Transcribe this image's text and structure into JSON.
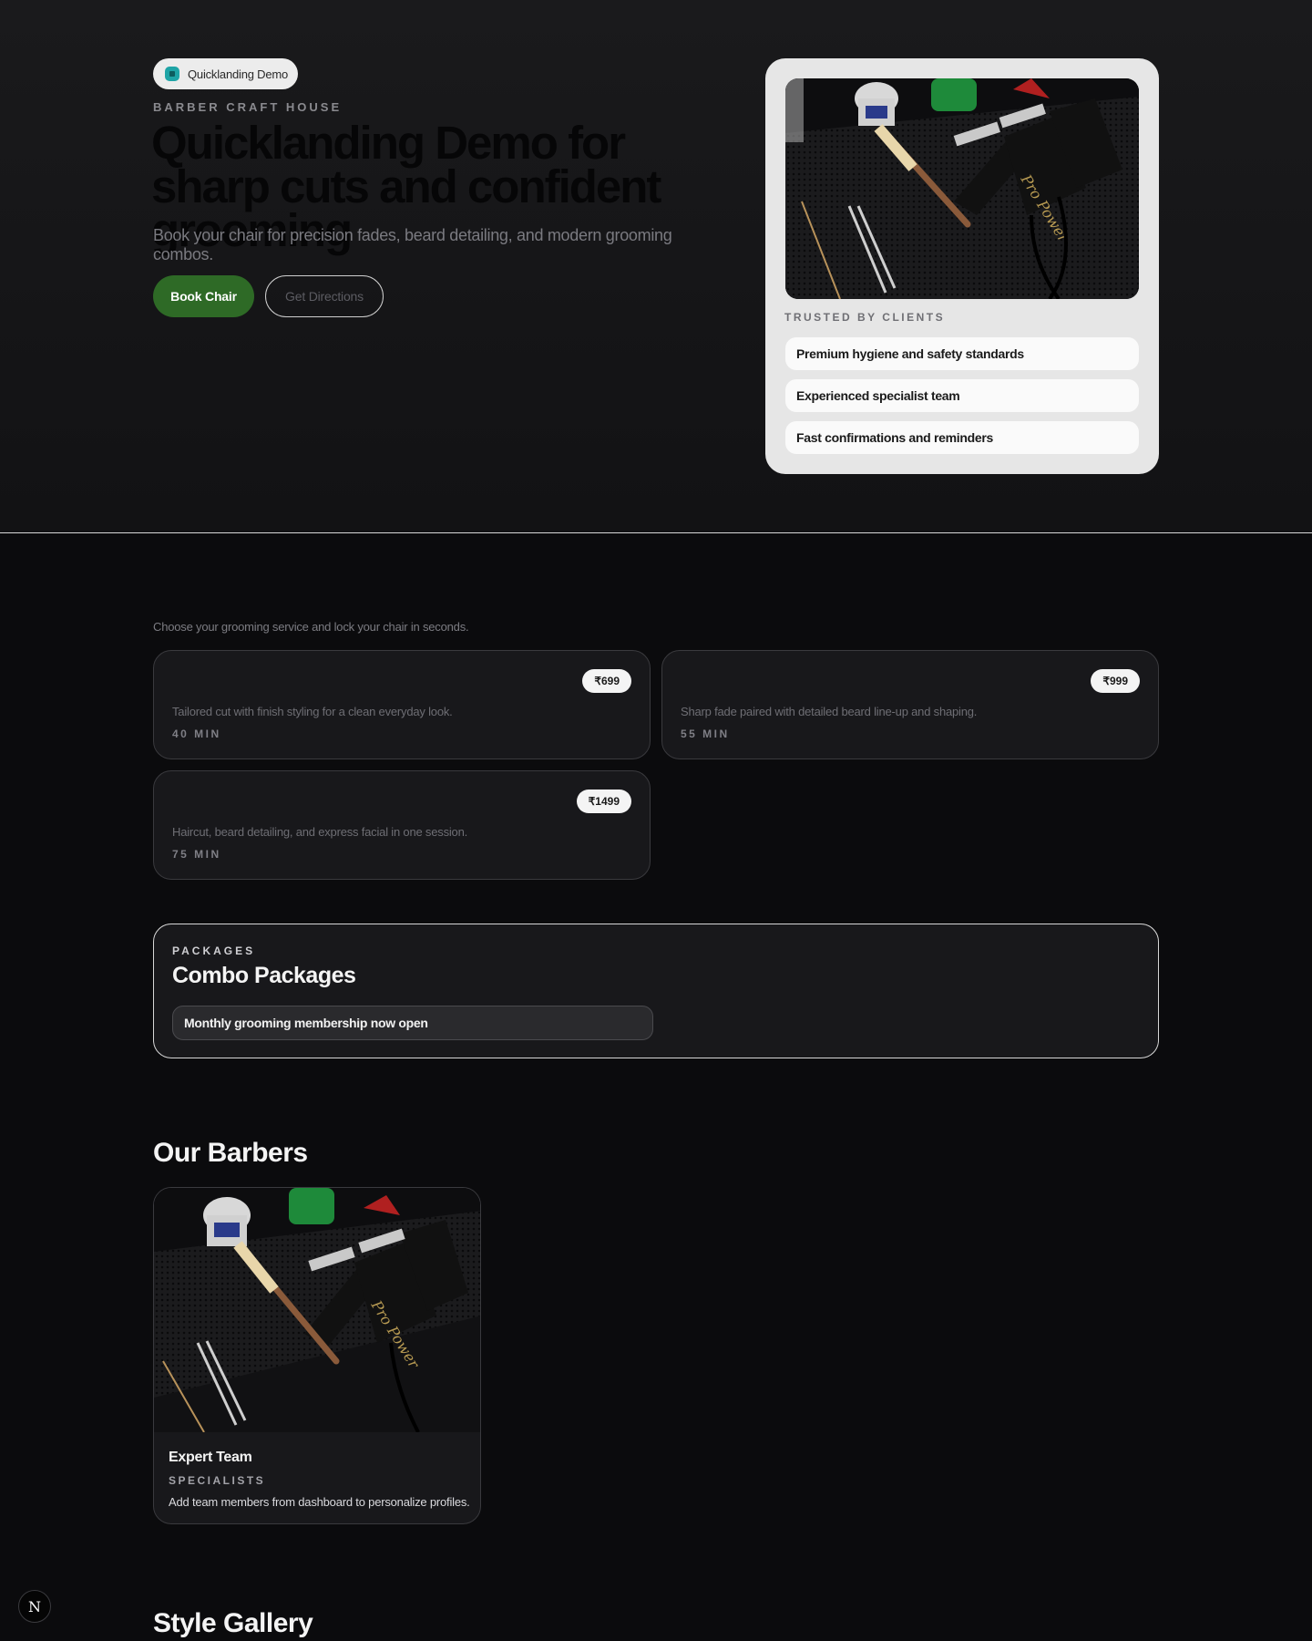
{
  "colors": {
    "background": "#0b0b0d",
    "accent_green": "#2e6a26",
    "card_light": "#e6e6e6",
    "card_dark": "#18181b",
    "badge_logo": "#1ea4a6"
  },
  "hero": {
    "badge_label": "Quicklanding Demo",
    "badge_icon": "app-logo-icon",
    "eyebrow": "BARBER CRAFT HOUSE",
    "title": "Quicklanding Demo for sharp cuts and confident grooming",
    "subtitle": "Book your chair for precision fades, beard detailing, and modern grooming combos.",
    "primary_button": "Book Chair",
    "secondary_button": "Get Directions"
  },
  "trust": {
    "label": "TRUSTED BY CLIENTS",
    "items": [
      "Premium hygiene and safety standards",
      "Experienced specialist team",
      "Fast confirmations and reminders"
    ]
  },
  "services": {
    "intro": "Choose your grooming service and lock your chair in seconds.",
    "items": [
      {
        "price": "₹699",
        "description": "Tailored cut with finish styling for a clean everyday look.",
        "duration": "40 MIN"
      },
      {
        "price": "₹999",
        "description": "Sharp fade paired with detailed beard line-up and shaping.",
        "duration": "55 MIN"
      },
      {
        "price": "₹1499",
        "description": "Haircut, beard detailing, and express facial in one session.",
        "duration": "75 MIN"
      }
    ]
  },
  "packages": {
    "eyebrow": "PACKAGES",
    "title": "Combo Packages",
    "items": [
      "Monthly grooming membership now open"
    ]
  },
  "barbers": {
    "title": "Our Barbers",
    "members": [
      {
        "name": "Expert Team",
        "role": "SPECIALISTS",
        "note": "Add team members from dashboard to personalize profiles."
      }
    ]
  },
  "gallery": {
    "title": "Style Gallery"
  },
  "floating_button": {
    "label": "N",
    "icon": "nextjs-logo-icon"
  }
}
